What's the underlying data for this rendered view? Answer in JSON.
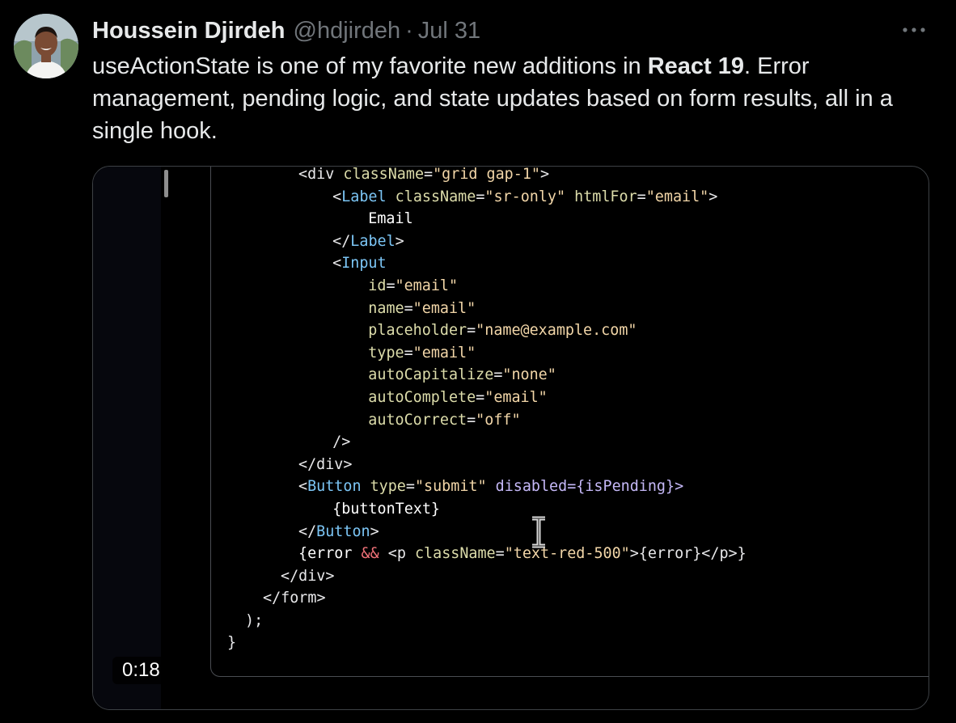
{
  "tweet": {
    "author_name": "Houssein Djirdeh",
    "author_handle": "@hdjirdeh",
    "separator": "·",
    "date": "Jul 31",
    "more_icon": "more-horizontal-icon",
    "text_before": "useActionState is one of my favorite new additions in ",
    "text_bold": "React 19",
    "text_after": ". Error management, pending logic, and state updates based on form results, all in a single hook."
  },
  "video": {
    "timestamp": "0:18",
    "code_lines": [
      [
        {
          "t": "<",
          "c": "punc"
        },
        {
          "t": "div",
          "c": "punc"
        },
        {
          "t": " "
        },
        {
          "t": "className",
          "c": "attr"
        },
        {
          "t": "=",
          "c": "eq"
        },
        {
          "t": "\"grid gap-1\"",
          "c": "str"
        },
        {
          "t": ">",
          "c": "punc"
        }
      ],
      [
        {
          "t": "  <",
          "c": "punc"
        },
        {
          "t": "Label",
          "c": "tag"
        },
        {
          "t": " "
        },
        {
          "t": "className",
          "c": "attr"
        },
        {
          "t": "=",
          "c": "eq"
        },
        {
          "t": "\"sr-only\"",
          "c": "str"
        },
        {
          "t": " "
        },
        {
          "t": "htmlFor",
          "c": "attr"
        },
        {
          "t": "=",
          "c": "eq"
        },
        {
          "t": "\"email\"",
          "c": "str"
        },
        {
          "t": ">",
          "c": "punc"
        }
      ],
      [
        {
          "t": "    Email",
          "c": "text"
        }
      ],
      [
        {
          "t": "  </",
          "c": "punc"
        },
        {
          "t": "Label",
          "c": "tag"
        },
        {
          "t": ">",
          "c": "punc"
        }
      ],
      [
        {
          "t": "  <",
          "c": "punc"
        },
        {
          "t": "Input",
          "c": "tag"
        }
      ],
      [
        {
          "t": "    "
        },
        {
          "t": "id",
          "c": "attr"
        },
        {
          "t": "=",
          "c": "eq"
        },
        {
          "t": "\"email\"",
          "c": "str"
        }
      ],
      [
        {
          "t": "    "
        },
        {
          "t": "name",
          "c": "attr"
        },
        {
          "t": "=",
          "c": "eq"
        },
        {
          "t": "\"email\"",
          "c": "str"
        }
      ],
      [
        {
          "t": "    "
        },
        {
          "t": "placeholder",
          "c": "attr"
        },
        {
          "t": "=",
          "c": "eq"
        },
        {
          "t": "\"name@example.com\"",
          "c": "str"
        }
      ],
      [
        {
          "t": "    "
        },
        {
          "t": "type",
          "c": "attr"
        },
        {
          "t": "=",
          "c": "eq"
        },
        {
          "t": "\"email\"",
          "c": "str"
        }
      ],
      [
        {
          "t": "    "
        },
        {
          "t": "autoCapitalize",
          "c": "attr"
        },
        {
          "t": "=",
          "c": "eq"
        },
        {
          "t": "\"none\"",
          "c": "str"
        }
      ],
      [
        {
          "t": "    "
        },
        {
          "t": "autoComplete",
          "c": "attr"
        },
        {
          "t": "=",
          "c": "eq"
        },
        {
          "t": "\"email\"",
          "c": "str"
        }
      ],
      [
        {
          "t": "    "
        },
        {
          "t": "autoCorrect",
          "c": "attr"
        },
        {
          "t": "=",
          "c": "eq"
        },
        {
          "t": "\"off\"",
          "c": "str"
        }
      ],
      [
        {
          "t": "  />",
          "c": "punc"
        }
      ],
      [
        {
          "t": "</",
          "c": "punc"
        },
        {
          "t": "div",
          "c": "punc"
        },
        {
          "t": ">",
          "c": "punc"
        }
      ],
      [
        {
          "t": "<",
          "c": "punc"
        },
        {
          "t": "Button",
          "c": "tag"
        },
        {
          "t": " "
        },
        {
          "t": "type",
          "c": "attr"
        },
        {
          "t": "=",
          "c": "eq"
        },
        {
          "t": "\"submit\"",
          "c": "str"
        },
        {
          "t": " "
        },
        {
          "t": "disabled",
          "c": "kw"
        },
        {
          "t": "={",
          "c": "kw"
        },
        {
          "t": "isPending",
          "c": "kw"
        },
        {
          "t": "}>",
          "c": "kw"
        }
      ],
      [
        {
          "t": "  {buttonText}",
          "c": "text"
        }
      ],
      [
        {
          "t": "</",
          "c": "punc"
        },
        {
          "t": "Button",
          "c": "tag"
        },
        {
          "t": ">",
          "c": "punc"
        }
      ],
      [
        {
          "t": "{error ",
          "c": "text"
        },
        {
          "t": "&&",
          "c": "op"
        },
        {
          "t": " <",
          "c": "punc"
        },
        {
          "t": "p",
          "c": "punc"
        },
        {
          "t": " "
        },
        {
          "t": "className",
          "c": "attr"
        },
        {
          "t": "=",
          "c": "eq"
        },
        {
          "t": "\"text-red-500\"",
          "c": "str"
        },
        {
          "t": ">{error}</",
          "c": "punc"
        },
        {
          "t": "p",
          "c": "punc"
        },
        {
          "t": ">}",
          "c": "punc"
        }
      ],
      [
        {
          "t": "</",
          "c": "punc"
        },
        {
          "t": "div",
          "c": "punc"
        },
        {
          "t": ">",
          "c": "punc"
        }
      ],
      [
        {
          "t": "</",
          "c": "punc"
        },
        {
          "t": "form",
          "c": "punc"
        },
        {
          "t": ">",
          "c": "punc"
        }
      ],
      [
        {
          "t": ");",
          "c": "punc"
        }
      ],
      [
        {
          "t": "}",
          "c": "punc"
        }
      ]
    ],
    "code_line_indents": [
      108,
      128,
      150,
      128,
      128,
      150,
      150,
      150,
      150,
      150,
      150,
      150,
      128,
      108,
      108,
      128,
      108,
      108,
      86,
      64,
      42,
      20
    ]
  }
}
